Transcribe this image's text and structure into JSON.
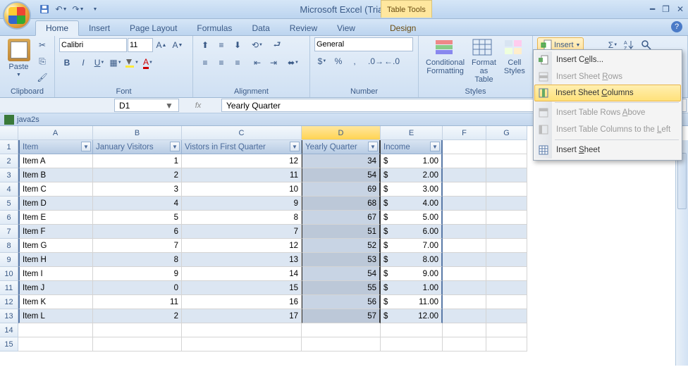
{
  "app": {
    "title": "Microsoft Excel (Trial)",
    "context_tab_title": "Table Tools"
  },
  "qat": {
    "save": "💾",
    "undo": "↶",
    "redo": "↷"
  },
  "tabs": [
    "Home",
    "Insert",
    "Page Layout",
    "Formulas",
    "Data",
    "Review",
    "View",
    "Design"
  ],
  "active_tab": "Home",
  "ribbon": {
    "clipboard": {
      "label": "Clipboard",
      "paste": "Paste"
    },
    "font": {
      "label": "Font",
      "name": "Calibri",
      "size": "11"
    },
    "alignment": {
      "label": "Alignment"
    },
    "number": {
      "label": "Number",
      "format": "General"
    },
    "styles": {
      "label": "Styles",
      "cond": "Conditional Formatting",
      "fmt": "Format as Table",
      "cell": "Cell Styles"
    },
    "cells_insert": "Insert"
  },
  "namebox": "D1",
  "formula": "Yearly Quarter",
  "workbook": "java2s",
  "columns": [
    "A",
    "B",
    "C",
    "D",
    "E",
    "F",
    "G"
  ],
  "headers": [
    "Item",
    "January Visitors",
    "Vistors in First Quarter",
    "Yearly Quarter",
    "Income"
  ],
  "rows": [
    {
      "item": "Item A",
      "jan": "1",
      "q1": "12",
      "yr": "34",
      "cur": "$",
      "inc": "1.00"
    },
    {
      "item": "Item B",
      "jan": "2",
      "q1": "11",
      "yr": "54",
      "cur": "$",
      "inc": "2.00"
    },
    {
      "item": "Item C",
      "jan": "3",
      "q1": "10",
      "yr": "69",
      "cur": "$",
      "inc": "3.00"
    },
    {
      "item": "Item D",
      "jan": "4",
      "q1": "9",
      "yr": "68",
      "cur": "$",
      "inc": "4.00"
    },
    {
      "item": "Item E",
      "jan": "5",
      "q1": "8",
      "yr": "67",
      "cur": "$",
      "inc": "5.00"
    },
    {
      "item": "Item F",
      "jan": "6",
      "q1": "7",
      "yr": "51",
      "cur": "$",
      "inc": "6.00"
    },
    {
      "item": "Item G",
      "jan": "7",
      "q1": "12",
      "yr": "52",
      "cur": "$",
      "inc": "7.00"
    },
    {
      "item": "Item H",
      "jan": "8",
      "q1": "13",
      "yr": "53",
      "cur": "$",
      "inc": "8.00"
    },
    {
      "item": "Item I",
      "jan": "9",
      "q1": "14",
      "yr": "54",
      "cur": "$",
      "inc": "9.00"
    },
    {
      "item": "Item J",
      "jan": "0",
      "q1": "15",
      "yr": "55",
      "cur": "$",
      "inc": "1.00"
    },
    {
      "item": "Item K",
      "jan": "11",
      "q1": "16",
      "yr": "56",
      "cur": "$",
      "inc": "11.00"
    },
    {
      "item": "Item L",
      "jan": "2",
      "q1": "17",
      "yr": "57",
      "cur": "$",
      "inc": "12.00"
    }
  ],
  "menu": {
    "cells": "Insert Cells...",
    "rows": "Insert Sheet Rows",
    "cols": "Insert Sheet Columns",
    "trows": "Insert Table Rows Above",
    "tcols": "Insert Table Columns to the Left",
    "sheet": "Insert Sheet"
  }
}
